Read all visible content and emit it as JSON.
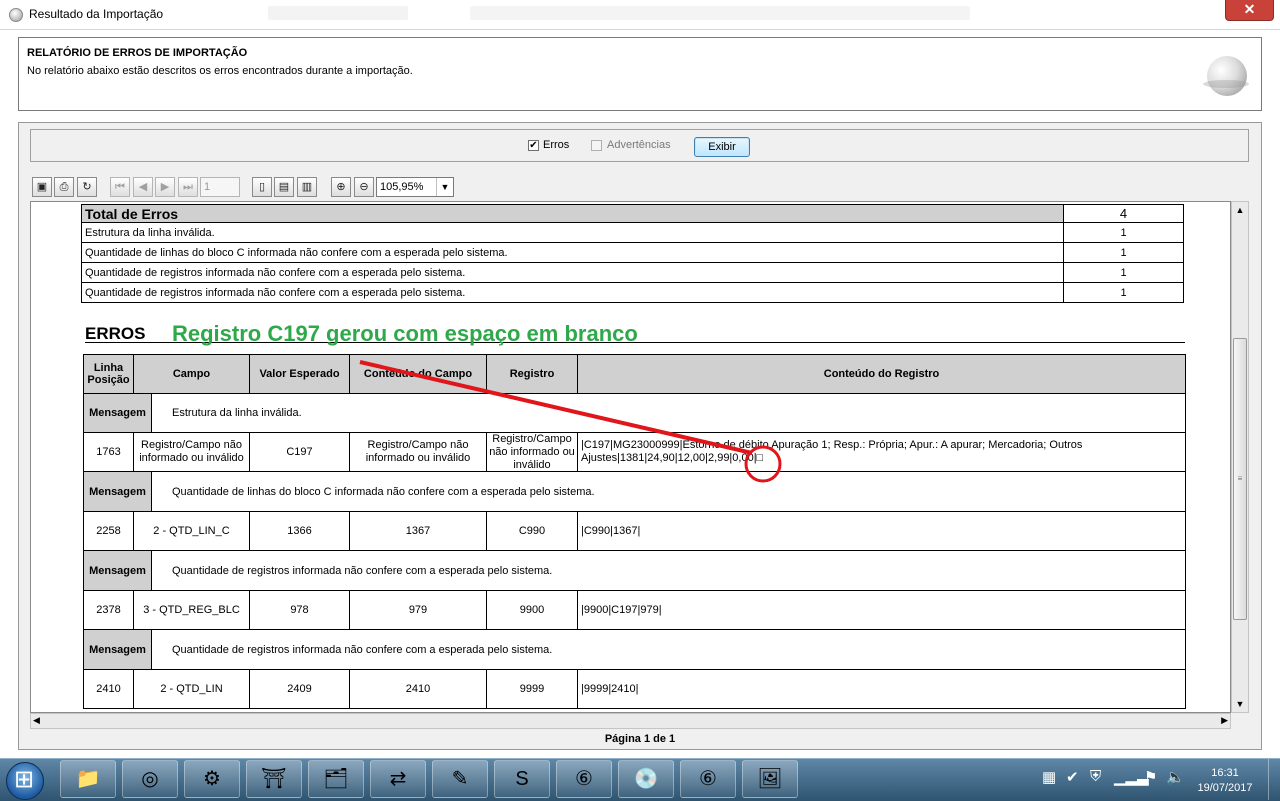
{
  "window": {
    "title": "Resultado da Importação"
  },
  "header": {
    "title": "RELATÓRIO DE ERROS DE IMPORTAÇÃO",
    "description": "No relatório abaixo estão descritos os erros encontrados durante a importação."
  },
  "filter": {
    "erros_label": "Erros",
    "erros_checked": true,
    "advertencias_label": "Advertências",
    "advertencias_checked": false,
    "exibir_label": "Exibir"
  },
  "toolbar": {
    "page_value": "1",
    "zoom": "105,95%"
  },
  "totals": {
    "header_label": "Total de Erros",
    "header_count": "4",
    "rows": [
      {
        "label": "Estrutura da linha inválida.",
        "count": "1"
      },
      {
        "label": "Quantidade de linhas do bloco C informada não confere com a esperada pelo sistema.",
        "count": "1"
      },
      {
        "label": "Quantidade de registros informada não confere com a esperada pelo sistema.",
        "count": "1"
      },
      {
        "label": "Quantidade de registros informada não confere com a esperada pelo sistema.",
        "count": "1"
      }
    ]
  },
  "erros": {
    "title": "ERROS",
    "columns": [
      "Linha Posição",
      "Campo",
      "Valor Esperado",
      "Conteúdo do Campo",
      "Registro",
      "Conteúdo do Registro"
    ],
    "message_label": "Mensagem",
    "groups": [
      {
        "mensagem": "Estrutura da linha inválida.",
        "linha": "1763",
        "campo": "Registro/Campo não informado ou inválido",
        "valor_esperado": "C197",
        "conteudo_campo": "Registro/Campo não informado ou inválido",
        "registro": "Registro/Campo não informado ou inválido",
        "conteudo_registro": "|C197|MG23000999|Estorno de débito Apuração 1; Resp.: Própria; Apur.: A apurar; Mercadoria; Outros Ajustes|1381|24,90|12,00|2,99|0,00|□"
      },
      {
        "mensagem": "Quantidade de linhas do bloco C informada não confere com a esperada pelo sistema.",
        "linha": "2258",
        "campo": "2 - QTD_LIN_C",
        "valor_esperado": "1366",
        "conteudo_campo": "1367",
        "registro": "C990",
        "conteudo_registro": "|C990|1367|"
      },
      {
        "mensagem": "Quantidade de registros informada não confere com a esperada pelo sistema.",
        "linha": "2378",
        "campo": "3 - QTD_REG_BLC",
        "valor_esperado": "978",
        "conteudo_campo": "979",
        "registro": "9900",
        "conteudo_registro": "|9900|C197|979|"
      },
      {
        "mensagem": "Quantidade de registros informada não confere com a esperada pelo sistema.",
        "linha": "2410",
        "campo": "2 - QTD_LIN",
        "valor_esperado": "2409",
        "conteudo_campo": "2410",
        "registro": "9999",
        "conteudo_registro": "|9999|2410|"
      }
    ]
  },
  "footer": {
    "page_label": "Página 1 de 1"
  },
  "annotation": {
    "text": "Registro C197 gerou com espaço em branco",
    "color": "#2fa84a",
    "marker_color": "#e0161b"
  },
  "taskbar": {
    "apps": [
      "folder-icon",
      "chrome-icon",
      "network-app-icon",
      "red-app-icon",
      "office-tools-icon",
      "teamviewer-icon",
      "notepad-icon",
      "skype-icon",
      "sped-fiscal-icon",
      "disk-app-icon",
      "sped-fiscal-2-icon",
      "image-viewer-icon"
    ],
    "time": "16:31",
    "date": "19/07/2017"
  }
}
